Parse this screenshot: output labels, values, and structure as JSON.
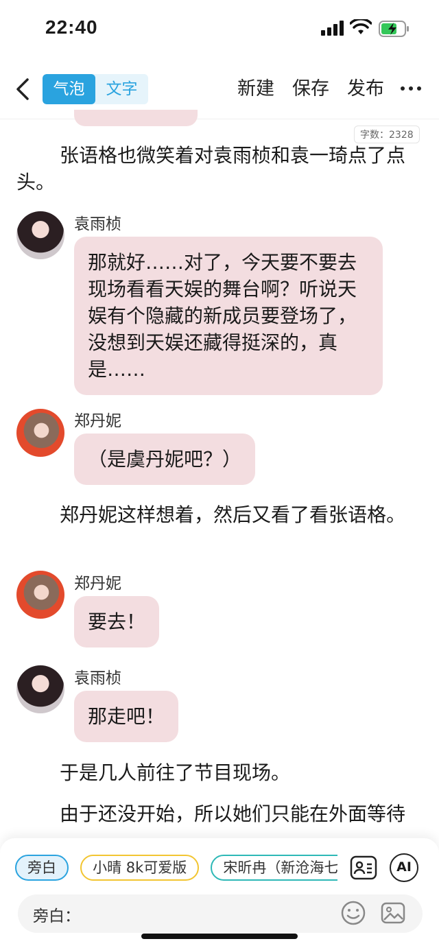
{
  "status": {
    "time": "22:40"
  },
  "nav": {
    "seg_bubble": "气泡",
    "seg_text": "文字",
    "new": "新建",
    "save": "保存",
    "publish": "发布"
  },
  "word_count": "字数：2328",
  "messages": {
    "n1": "张语格也微笑着对袁雨桢和袁一琦点了点头。",
    "m1_sender": "袁雨桢",
    "m1_text": "那就好……对了，今天要不要去现场看看天娱的舞台啊？听说天娱有个隐藏的新成员要登场了，没想到天娱还藏得挺深的，真是……",
    "m2_sender": "郑丹妮",
    "m2_text": "（是虞丹妮吧？）",
    "n2": "郑丹妮这样想着，然后又看了看张语格。",
    "m3_sender": "郑丹妮",
    "m3_text": "要去！",
    "m4_sender": "袁雨桢",
    "m4_text": "那走吧！",
    "n3": "于是几人前往了节目现场。",
    "n4": "由于还没开始，所以她们只能在外面等待"
  },
  "bottom": {
    "chip1": "旁白",
    "chip2": "小晴 8k可爱版",
    "chip3": "宋昕冉（新沧海七",
    "ai": "AI",
    "input_label": "旁白："
  },
  "colors": {
    "accent": "#2aa3df",
    "bubble": "#f3dde0"
  },
  "icons": [
    "back-icon",
    "more-icon",
    "contact-card-icon",
    "ai-icon",
    "emoji-icon",
    "image-icon"
  ]
}
